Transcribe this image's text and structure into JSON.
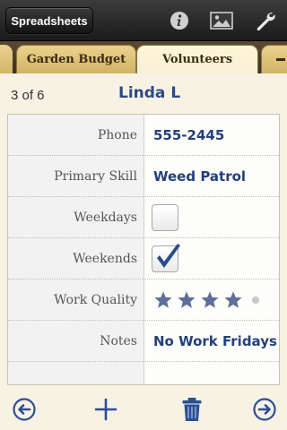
{
  "toolbar": {
    "spreadsheets_label": "Spreadsheets",
    "icons": [
      "info-icon",
      "image-icon",
      "wrench-icon"
    ]
  },
  "tabs": [
    {
      "label": "Garden Budget",
      "selected": false
    },
    {
      "label": "Volunteers",
      "selected": true
    }
  ],
  "record": {
    "counter": "3 of 6",
    "name": "Linda L"
  },
  "fields": [
    {
      "label": "Phone",
      "value": "555-2445"
    },
    {
      "label": "Primary Skill",
      "value": "Weed Patrol"
    },
    {
      "label": "Weekdays",
      "checked": false
    },
    {
      "label": "Weekends",
      "checked": true
    },
    {
      "label": "Work Quality",
      "rating": 4,
      "max_rating": 5
    },
    {
      "label": "Notes",
      "value": "No Work Fridays"
    }
  ],
  "bottom_toolbar": {
    "icons": [
      "previous-arrow-icon",
      "add-icon",
      "trash-icon",
      "next-arrow-icon"
    ]
  },
  "colors": {
    "accent_blue": "#2d4a86",
    "value_text": "#23407a",
    "tab_gold": "#d9bc72"
  }
}
